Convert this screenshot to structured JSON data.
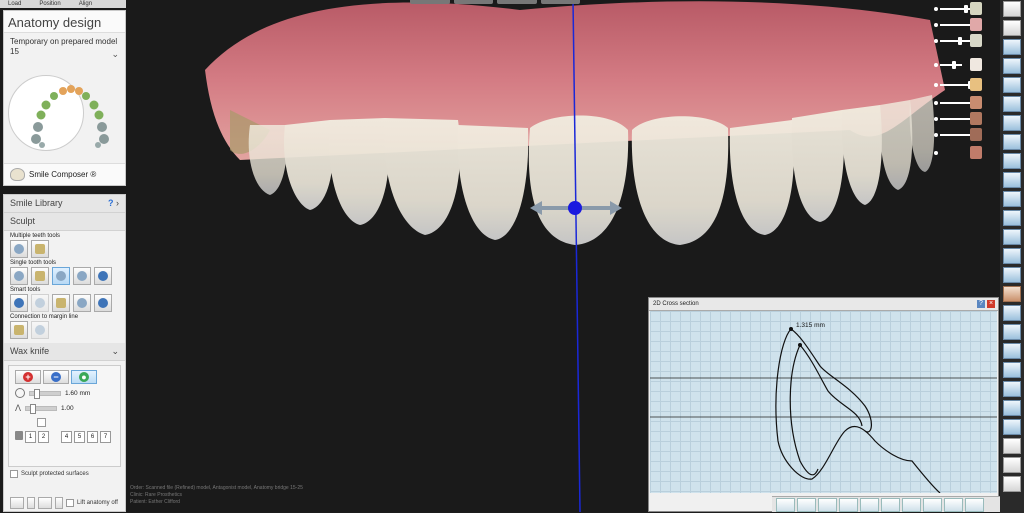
{
  "top_strip": {
    "items": [
      "Load",
      "Position",
      "Align"
    ]
  },
  "anatomy_panel": {
    "title": "Anatomy design",
    "subtitle": "Temporary on prepared model 15",
    "smile_composer_label": "Smile Composer ®"
  },
  "library_panel": {
    "smile_library": "Smile Library",
    "help": "?",
    "sculpt": "Sculpt",
    "multiple_teeth_tools": "Multiple teeth tools",
    "single_tooth_tools": "Single tooth tools",
    "smart_tools": "Smart tools",
    "connection_to_margin_line": "Connection to margin line",
    "wax_knife": "Wax knife",
    "wax_size": "1.60 mm",
    "wax_strength": "1.00",
    "num_buttons": [
      "1",
      "2",
      "4",
      "5",
      "6",
      "7"
    ],
    "sculpt_protected": "Sculpt protected surfaces",
    "lift_anatomy_off": "Lift anatomy off"
  },
  "cross_section": {
    "title": "2D Cross section",
    "measurement": "1.315 mm"
  },
  "footer": {
    "lines": [
      "Order:   Scanned file (Refined) model, Antagonist model, Anatomy bridge 15-25",
      "Clinic:  Rare Prosthetics",
      "Patient: Esther Clifford"
    ]
  },
  "colors": {
    "axis_line": "#1a28d8",
    "gizmo": "#1a1adf",
    "gum": "#c96a75",
    "tooth": "#e8e4d6",
    "accent": "#3e74b8"
  },
  "icons": {
    "right_toolbar": [
      "globe-icon",
      "layers-icon",
      "model-icon",
      "teeth-icon",
      "clip-icon",
      "scan-icon",
      "settings-icon",
      "view-icon"
    ]
  }
}
